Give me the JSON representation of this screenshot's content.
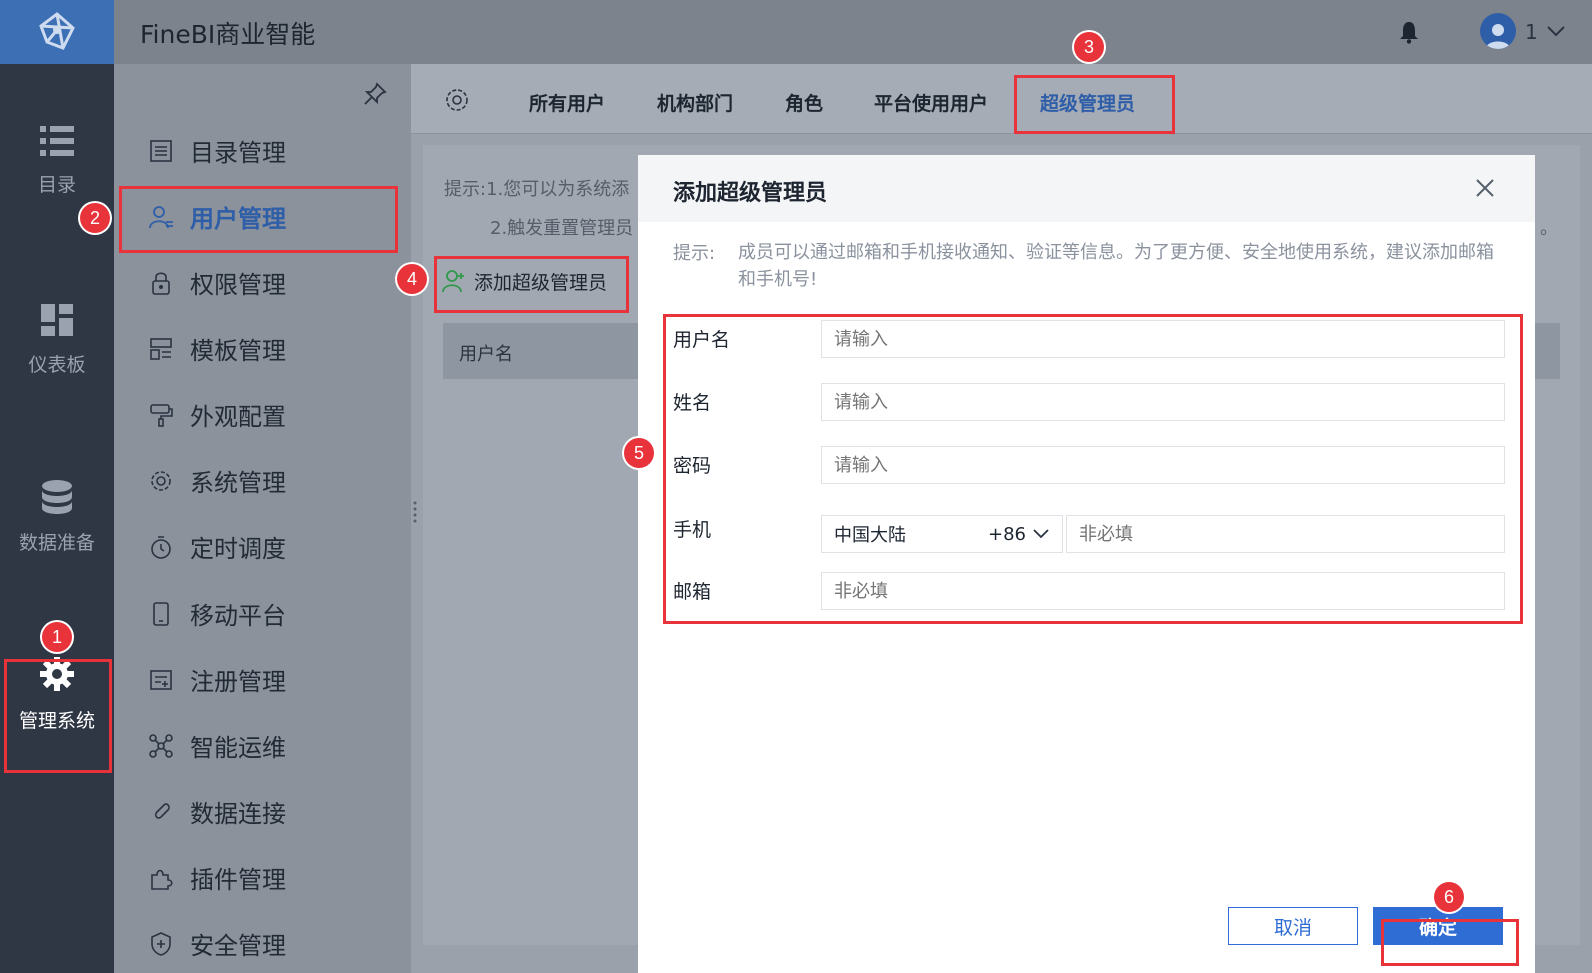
{
  "header": {
    "app_title": "FineBI商业智能",
    "user_label": "1"
  },
  "rail": {
    "items": [
      {
        "label": "目录",
        "icon": "list-icon"
      },
      {
        "label": "仪表板",
        "icon": "dashboard-icon"
      },
      {
        "label": "数据准备",
        "icon": "database-icon"
      },
      {
        "label": "管理系统",
        "icon": "gear-icon"
      }
    ]
  },
  "menu": {
    "items": [
      {
        "label": "目录管理",
        "icon": "catalog-icon"
      },
      {
        "label": "用户管理",
        "icon": "user-icon"
      },
      {
        "label": "权限管理",
        "icon": "lock-icon"
      },
      {
        "label": "模板管理",
        "icon": "template-icon"
      },
      {
        "label": "外观配置",
        "icon": "paint-icon"
      },
      {
        "label": "系统管理",
        "icon": "settings-icon"
      },
      {
        "label": "定时调度",
        "icon": "timer-icon"
      },
      {
        "label": "移动平台",
        "icon": "mobile-icon"
      },
      {
        "label": "注册管理",
        "icon": "register-icon"
      },
      {
        "label": "智能运维",
        "icon": "ops-icon"
      },
      {
        "label": "数据连接",
        "icon": "link-icon"
      },
      {
        "label": "插件管理",
        "icon": "plugin-icon"
      },
      {
        "label": "安全管理",
        "icon": "shield-icon"
      }
    ],
    "active_index": 1
  },
  "tabs": {
    "items": [
      "所有用户",
      "机构部门",
      "角色",
      "平台使用用户",
      "超级管理员"
    ],
    "active_index": 4
  },
  "page": {
    "hint_1": "提示:1.您可以为系统添",
    "hint_2": "2.触发重置管理员",
    "hint_tail": "。",
    "add_button": "添加超级管理员",
    "table_header": "用户名"
  },
  "modal": {
    "title": "添加超级管理员",
    "hint_label": "提示:",
    "hint_text": "成员可以通过邮箱和手机接收通知、验证等信息。为了更方便、安全地使用系统，建议添加邮箱和手机号!",
    "fields": {
      "username": {
        "label": "用户名",
        "placeholder": "请输入"
      },
      "name": {
        "label": "姓名",
        "placeholder": "请输入"
      },
      "password": {
        "label": "密码",
        "placeholder": "请输入"
      },
      "phone": {
        "label": "手机",
        "region": "中国大陆",
        "code": "+86",
        "placeholder": "非必填"
      },
      "email": {
        "label": "邮箱",
        "placeholder": "非必填"
      }
    },
    "cancel_label": "取消",
    "ok_label": "确定"
  },
  "annotations": [
    "1",
    "2",
    "3",
    "4",
    "5",
    "6"
  ],
  "colors": {
    "accent": "#2f6cd4",
    "highlight": "#e8333a",
    "rail_bg": "#2f3745",
    "logo_bg": "#3d6fb5"
  }
}
